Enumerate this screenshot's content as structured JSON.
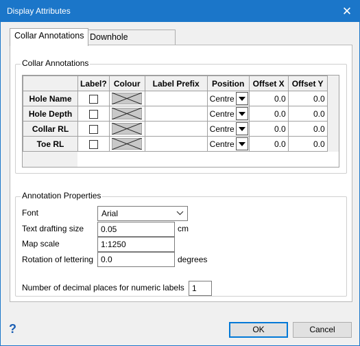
{
  "window": {
    "title": "Display Attributes",
    "close_glyph": "✕"
  },
  "tabs": [
    {
      "label": "Collar Annotations",
      "active": true
    },
    {
      "label": "Downhole Annotations",
      "active": false
    }
  ],
  "collar_group": {
    "title": "Collar Annotations",
    "columns": [
      "Label?",
      "Colour",
      "Label Prefix",
      "Position",
      "Offset X",
      "Offset Y"
    ],
    "rows": [
      {
        "name": "Hole Name",
        "label_checked": false,
        "prefix": "",
        "position": "Centre",
        "offset_x": "0.0",
        "offset_y": "0.0"
      },
      {
        "name": "Hole Depth",
        "label_checked": false,
        "prefix": "",
        "position": "Centre",
        "offset_x": "0.0",
        "offset_y": "0.0"
      },
      {
        "name": "Collar RL",
        "label_checked": false,
        "prefix": "",
        "position": "Centre",
        "offset_x": "0.0",
        "offset_y": "0.0"
      },
      {
        "name": "Toe RL",
        "label_checked": false,
        "prefix": "",
        "position": "Centre",
        "offset_x": "0.0",
        "offset_y": "0.0"
      }
    ]
  },
  "annotation_props": {
    "title": "Annotation Properties",
    "font_label": "Font",
    "font_value": "Arial",
    "text_size_label": "Text drafting size",
    "text_size_value": "0.05",
    "text_size_unit": "cm",
    "map_scale_label": "Map scale",
    "map_scale_value": "1:1250",
    "rotation_label": "Rotation of lettering",
    "rotation_value": "0.0",
    "rotation_unit": "degrees",
    "decimals_label": "Number of decimal places for numeric labels",
    "decimals_value": "1"
  },
  "footer": {
    "help_glyph": "?",
    "ok_label": "OK",
    "cancel_label": "Cancel"
  },
  "colors": {
    "titlebar": "#1b76c9",
    "accent": "#0078d7"
  }
}
